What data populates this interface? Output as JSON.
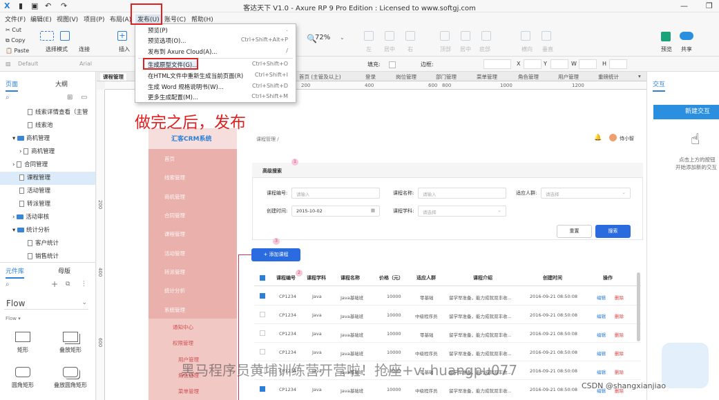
{
  "window": {
    "title": "客达天下 V1.0 - Axure RP 9 Pro Edition : Licensed to www.softgj.com"
  },
  "menubar": [
    "文件(F)",
    "编辑(E)",
    "视图(V)",
    "项目(P)",
    "布局(A)",
    "发布(U)",
    "账号(C)",
    "帮助(H)"
  ],
  "toolbar": {
    "cut": "Cut",
    "copy": "Copy",
    "paste": "Paste",
    "select_mode": "选择模式",
    "connect": "连接",
    "insert": "插入",
    "zoom": "72%",
    "preview": "预览",
    "share": "共享",
    "faded": [
      "左",
      "居中",
      "右",
      "顶部",
      "居中",
      "底部",
      "横向",
      "垂直"
    ]
  },
  "formatbar": {
    "style": "Default",
    "font": "Arial",
    "fill_label": "填充:",
    "border_label": "边框:",
    "x": "X",
    "y": "Y",
    "w": "W",
    "h": "H"
  },
  "publish_menu": [
    {
      "label": "预览(P)",
      "shortcut": "."
    },
    {
      "label": "预览选项(O)...",
      "shortcut": "Ctrl+Shift+Alt+P"
    },
    {
      "label": "发布到 Axure Cloud(A)...",
      "shortcut": "/"
    },
    {
      "label": "生成原型文件(G)...",
      "shortcut": "Ctrl+Shift+O"
    },
    {
      "label": "在HTML文件中重新生成当前页面(R)",
      "shortcut": "Ctrl+Shift+I"
    },
    {
      "label": "生成 Word 规格说明书(W)...",
      "shortcut": "Ctrl+Shift+D"
    },
    {
      "label": "更多生成配置(M)...",
      "shortcut": "Ctrl+Shift+M"
    }
  ],
  "annotation": "做完之后，发布",
  "left_panel": {
    "tabs": [
      "页面",
      "大纲"
    ],
    "tree": [
      "线索详情查看（主管",
      "线索池",
      "商机管理",
      "商机管理",
      "合同管理",
      "课程管理",
      "活动管理",
      "转派管理",
      "活动审核",
      "统计分析",
      "客户统计",
      "销售统计"
    ],
    "lib_tabs": [
      "元件库",
      "母版"
    ],
    "lib_name": "Flow",
    "lib_section": "Flow",
    "lib_items": [
      "矩形",
      "叠放矩形",
      "圆角矩形",
      "叠放圆角矩形"
    ]
  },
  "canvas_tabs": [
    "课程管理",
    "首页 (主管及以上)",
    "登录",
    "岗位管理",
    "部门管理",
    "菜单管理",
    "角色管理",
    "用户管理",
    "重磅统计"
  ],
  "ruler": {
    "h": [
      "200",
      "400",
      "600",
      "800",
      "1000",
      "1200"
    ],
    "v": [
      "200",
      "400",
      "600"
    ]
  },
  "proto": {
    "logo": "汇客CRM系统",
    "breadcrumb": "课程管理 /",
    "user": "侍小智",
    "side": [
      "首页",
      "线索管理",
      "商机管理",
      "合同管理",
      "课程管理",
      "活动管理",
      "转派管理",
      "统计分析",
      "系统管理",
      "通知中心",
      "权限管理",
      "用户管理",
      "角色管理",
      "菜单管理"
    ],
    "search_title": "高级搜索",
    "f_code": "课程编号:",
    "f_name": "课程名称:",
    "f_crowd": "适应人群:",
    "f_time": "创建时间:",
    "f_subject": "课程学科:",
    "ph_input": "请输入",
    "ph_select": "请选择",
    "date": "2015-10-02",
    "btn_reset": "重置",
    "btn_search": "搜索",
    "btn_add": "+ 添加课程",
    "markers": [
      "1",
      "2",
      "3"
    ],
    "headers": [
      "课程编号",
      "课程学科",
      "课程名称",
      "价格（元）",
      "适应人群",
      "课程介绍",
      "创建时间",
      "操作"
    ],
    "row": [
      "CP1234",
      "Java",
      "Java基础班",
      "10000",
      "零基础",
      "留学早准备，能力成就双丰收...",
      "2016-09-21  08:50:08",
      "编辑",
      "删除"
    ],
    "row_alt": [
      "CP1234",
      "Java",
      "Java基础班",
      "10000",
      "中级程序员",
      "留学早准备，能力成就双丰收...",
      "2016-09-21  08:50:08",
      "编辑",
      "删除"
    ]
  },
  "right_panel": {
    "tab": "交互",
    "button": "新建交互",
    "hint1": "点击上方的按钮",
    "hint2": "开始添加新的交互"
  },
  "watermark": "黑马程序员黄埔训练营开营啦！抢座+v: huangpu077",
  "credit": "CSDN @shangxianjiao"
}
